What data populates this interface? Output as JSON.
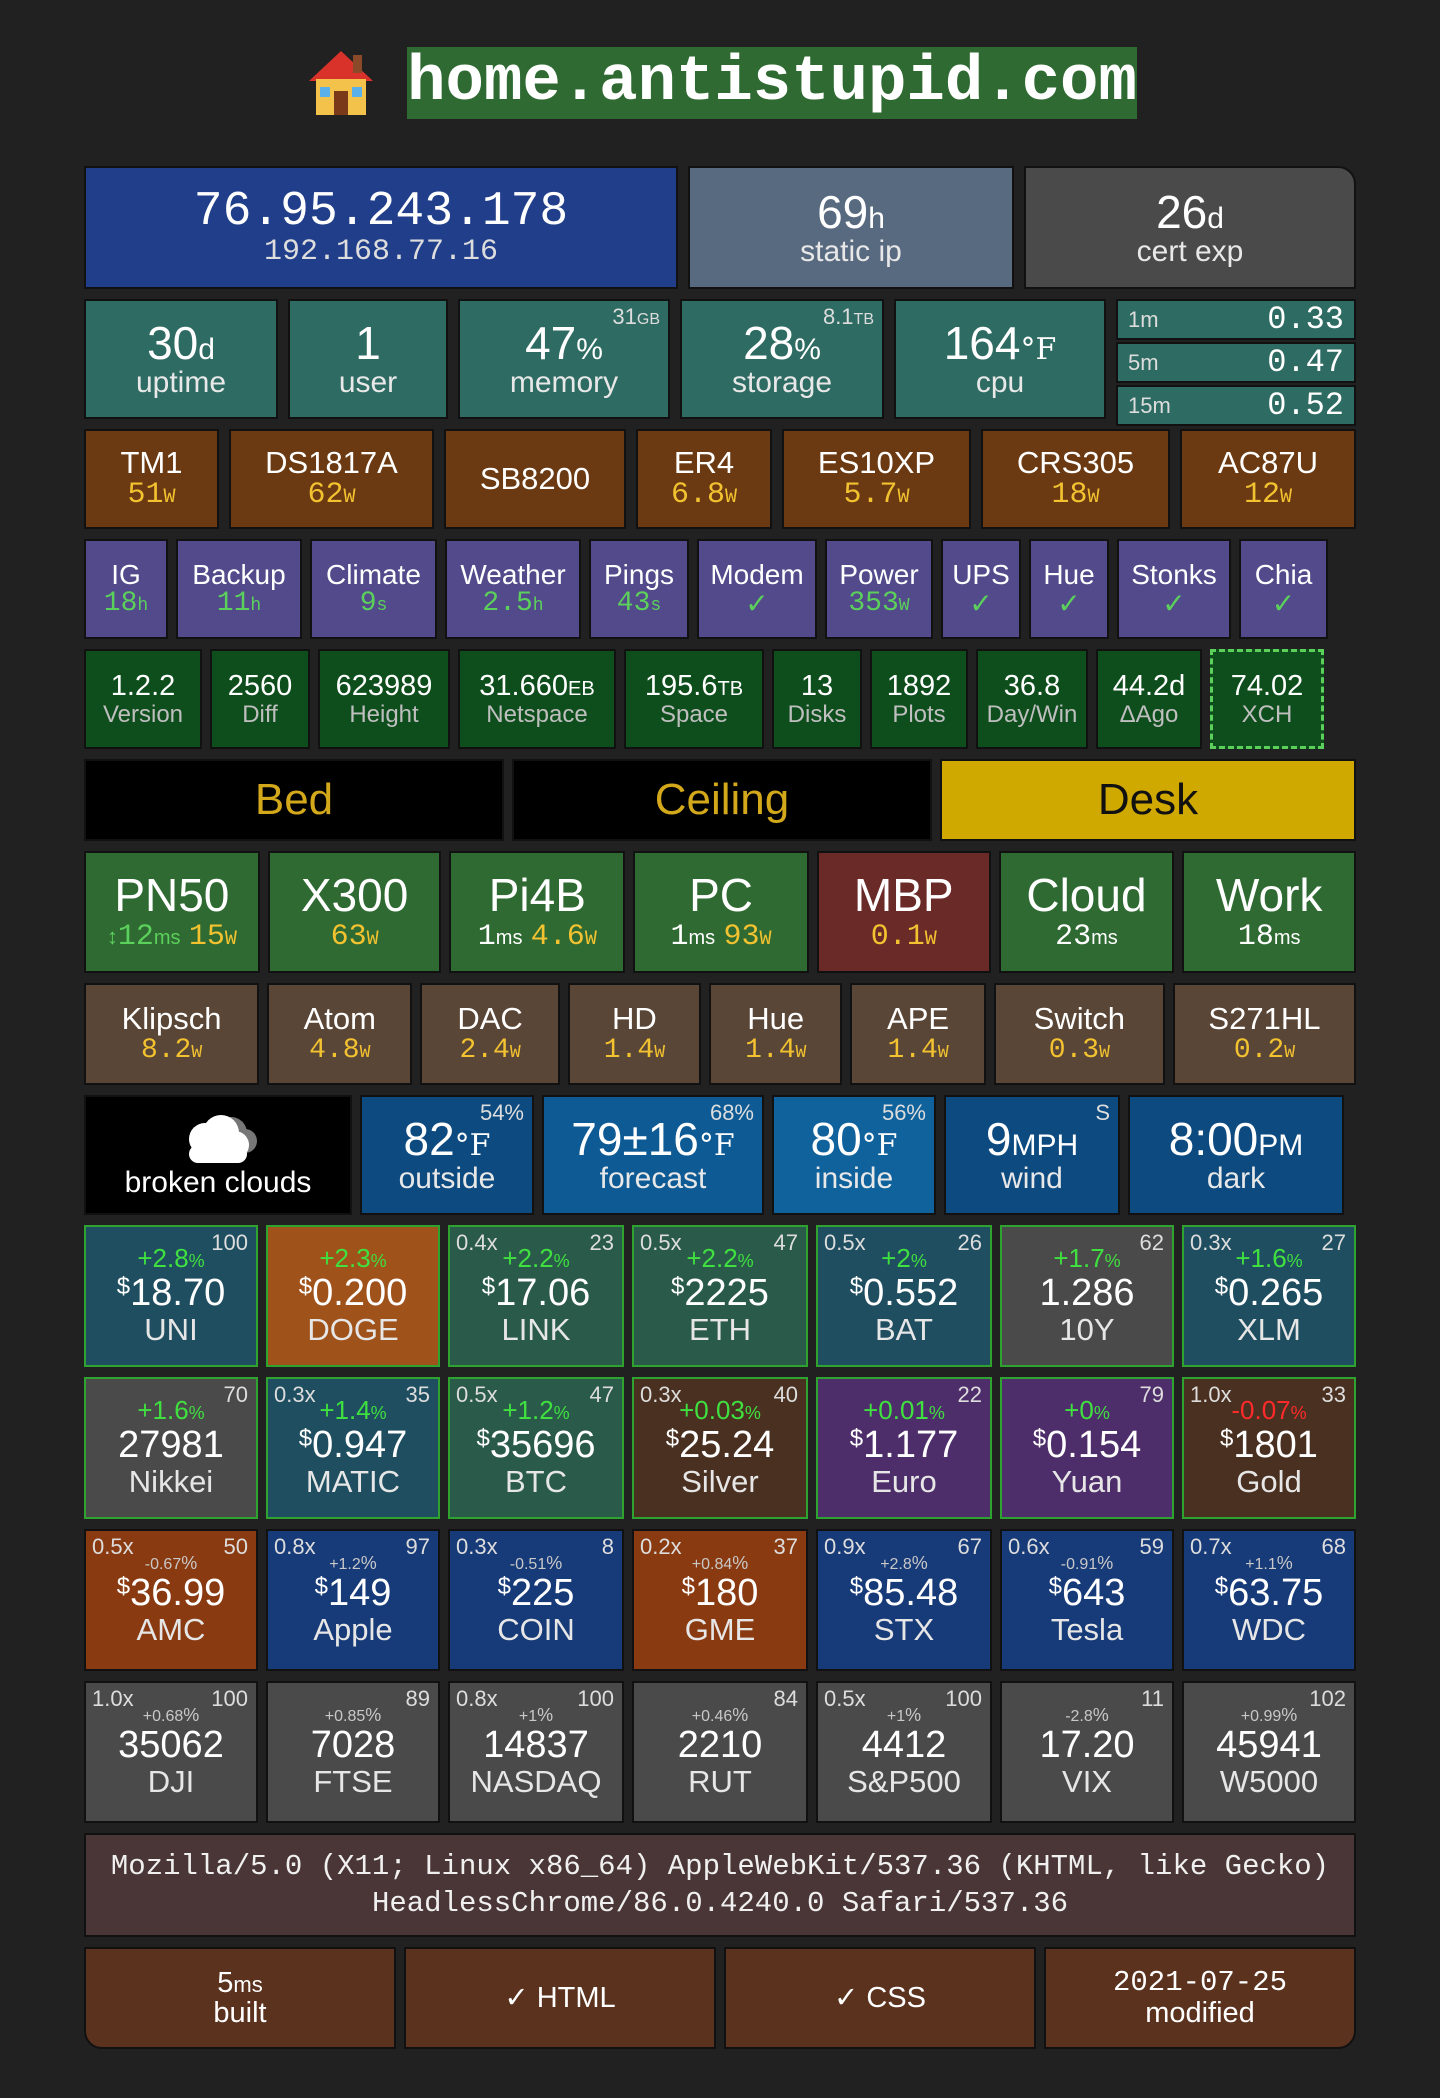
{
  "header": {
    "icon": "house-icon",
    "host": "home.antistupid.com"
  },
  "net": {
    "ip": "76.95.243.178",
    "lan": "192.168.77.16",
    "static_val": "69",
    "static_unit": "h",
    "static_lbl": "static ip",
    "cert_val": "26",
    "cert_unit": "d",
    "cert_lbl": "cert exp"
  },
  "sys": {
    "uptime_v": "30",
    "uptime_u": "d",
    "uptime_l": "uptime",
    "user_v": "1",
    "user_l": "user",
    "mem_v": "47",
    "mem_u": "%",
    "mem_l": "memory",
    "mem_c": "31",
    "mem_cu": "GB",
    "sto_v": "28",
    "sto_u": "%",
    "sto_l": "storage",
    "sto_c": "8.1",
    "sto_cu": "TB",
    "cpu_v": "164",
    "cpu_u": "°F",
    "cpu_l": "cpu",
    "load": [
      {
        "k": "1m",
        "v": "0.33"
      },
      {
        "k": "5m",
        "v": "0.47"
      },
      {
        "k": "15m",
        "v": "0.52"
      }
    ]
  },
  "devices": [
    {
      "n": "TM1",
      "w": "51",
      "u": "W"
    },
    {
      "n": "DS1817A",
      "w": "62",
      "u": "W"
    },
    {
      "n": "SB8200",
      "w": "",
      "u": ""
    },
    {
      "n": "ER4",
      "w": "6.8",
      "u": "W"
    },
    {
      "n": "ES10XP",
      "w": "5.7",
      "u": "W"
    },
    {
      "n": "CRS305",
      "w": "18",
      "u": "W"
    },
    {
      "n": "AC87U",
      "w": "12",
      "u": "W"
    }
  ],
  "services": [
    {
      "n": "IG",
      "v": "18",
      "u": "h"
    },
    {
      "n": "Backup",
      "v": "11",
      "u": "h"
    },
    {
      "n": "Climate",
      "v": "9",
      "u": "s"
    },
    {
      "n": "Weather",
      "v": "2.5",
      "u": "h"
    },
    {
      "n": "Pings",
      "v": "43",
      "u": "s"
    },
    {
      "n": "Modem",
      "v": "✓",
      "u": ""
    },
    {
      "n": "Power",
      "v": "353",
      "u": "W"
    },
    {
      "n": "UPS",
      "v": "✓",
      "u": ""
    },
    {
      "n": "Hue",
      "v": "✓",
      "u": ""
    },
    {
      "n": "Stonks",
      "v": "✓",
      "u": ""
    },
    {
      "n": "Chia",
      "v": "✓",
      "u": ""
    }
  ],
  "chia": [
    {
      "v": "1.2.2",
      "u": "",
      "l": "Version"
    },
    {
      "v": "2560",
      "u": "",
      "l": "Diff"
    },
    {
      "v": "623989",
      "u": "",
      "l": "Height"
    },
    {
      "v": "31.660",
      "u": "EB",
      "l": "Netspace"
    },
    {
      "v": "195.6",
      "u": "TB",
      "l": "Space"
    },
    {
      "v": "13",
      "u": "",
      "l": "Disks"
    },
    {
      "v": "1892",
      "u": "",
      "l": "Plots"
    },
    {
      "v": "36.8",
      "u": "",
      "l": "Day/Win"
    },
    {
      "v": "44.2d",
      "u": "",
      "l": "ΔAgo"
    },
    {
      "v": "74.02",
      "u": "",
      "l": "XCH"
    }
  ],
  "lights": [
    {
      "n": "Bed",
      "on": false
    },
    {
      "n": "Ceiling",
      "on": false
    },
    {
      "n": "Desk",
      "on": true
    }
  ],
  "hosts": [
    {
      "n": "PN50",
      "pre": "↕",
      "ms": "12",
      "w": "15"
    },
    {
      "n": "X300",
      "pre": "",
      "ms": "",
      "w": "63"
    },
    {
      "n": "Pi4B",
      "pre": "",
      "ms": "1",
      "w": "4.6"
    },
    {
      "n": "PC",
      "pre": "",
      "ms": "1",
      "w": "93"
    },
    {
      "n": "MBP",
      "pre": "",
      "ms": "",
      "w": "0.1"
    },
    {
      "n": "Cloud",
      "pre": "",
      "ms": "23",
      "w": ""
    },
    {
      "n": "Work",
      "pre": "",
      "ms": "18",
      "w": ""
    }
  ],
  "speakers": [
    {
      "n": "Klipsch",
      "w": "8.2"
    },
    {
      "n": "Atom",
      "w": "4.8"
    },
    {
      "n": "DAC",
      "w": "2.4"
    },
    {
      "n": "HD",
      "w": "1.4"
    },
    {
      "n": "Hue",
      "w": "1.4"
    },
    {
      "n": "APE",
      "w": "1.4"
    },
    {
      "n": "Switch",
      "w": "0.3"
    },
    {
      "n": "S271HL",
      "w": "0.2"
    }
  ],
  "weather": {
    "cond": "broken clouds",
    "cond_icon": "cloud-icon",
    "out_v": "82",
    "out_u": "°F",
    "out_h": "54%",
    "out_l": "outside",
    "fc_v": "79±16",
    "fc_u": "°F",
    "fc_h": "68%",
    "fc_l": "forecast",
    "in_v": "80",
    "in_u": "°F",
    "in_h": "56%",
    "in_l": "inside",
    "wind_v": "9",
    "wind_u": "MPH",
    "wind_d": "S",
    "wind_l": "wind",
    "time_v": "8:00",
    "time_u": "PM",
    "time_l": "dark"
  },
  "quotes": [
    [
      {
        "n": "UNI",
        "p": "$",
        "v": "18.70",
        "c": "+2.8",
        "x": "",
        "r": "100",
        "bg": "#1e4e60",
        "d": "up"
      },
      {
        "n": "DOGE",
        "p": "$",
        "v": "0.200",
        "c": "+2.3",
        "x": "",
        "r": "",
        "bg": "#a0521b",
        "d": "up"
      },
      {
        "n": "LINK",
        "p": "$",
        "v": "17.06",
        "c": "+2.2",
        "x": "0.4x",
        "r": "23",
        "bg": "#2a5a4a",
        "d": "up"
      },
      {
        "n": "ETH",
        "p": "$",
        "v": "2225",
        "c": "+2.2",
        "x": "0.5x",
        "r": "47",
        "bg": "#2a5a4a",
        "d": "up"
      },
      {
        "n": "BAT",
        "p": "$",
        "v": "0.552",
        "c": "+2",
        "x": "0.5x",
        "r": "26",
        "bg": "#1e4e60",
        "d": "up"
      },
      {
        "n": "10Y",
        "p": "",
        "v": "1.286",
        "c": "+1.7",
        "x": "",
        "r": "62",
        "bg": "#4a4a4a",
        "d": "up"
      },
      {
        "n": "XLM",
        "p": "$",
        "v": "0.265",
        "c": "+1.6",
        "x": "0.3x",
        "r": "27",
        "bg": "#1e4e60",
        "d": "up"
      }
    ],
    [
      {
        "n": "Nikkei",
        "p": "",
        "v": "27981",
        "c": "+1.6",
        "x": "",
        "r": "70",
        "bg": "#4a4a4a",
        "d": "up"
      },
      {
        "n": "MATIC",
        "p": "$",
        "v": "0.947",
        "c": "+1.4",
        "x": "0.3x",
        "r": "35",
        "bg": "#1e4e60",
        "d": "up"
      },
      {
        "n": "BTC",
        "p": "$",
        "v": "35696",
        "c": "+1.2",
        "x": "0.5x",
        "r": "47",
        "bg": "#2a5a4a",
        "d": "up"
      },
      {
        "n": "Silver",
        "p": "$",
        "v": "25.24",
        "c": "+0.03",
        "x": "0.3x",
        "r": "40",
        "bg": "#4a3020",
        "d": "up"
      },
      {
        "n": "Euro",
        "p": "$",
        "v": "1.177",
        "c": "+0.01",
        "x": "",
        "r": "22",
        "bg": "#4e2e6a",
        "d": "up"
      },
      {
        "n": "Yuan",
        "p": "$",
        "v": "0.154",
        "c": "+0",
        "x": "",
        "r": "79",
        "bg": "#4e2e6a",
        "d": "up"
      },
      {
        "n": "Gold",
        "p": "$",
        "v": "1801",
        "c": "-0.07",
        "x": "1.0x",
        "r": "33",
        "bg": "#4a3020",
        "d": "dn"
      }
    ],
    [
      {
        "n": "AMC",
        "p": "$",
        "v": "36.99",
        "c": "-0.67",
        "x": "0.5x",
        "r": "50",
        "bg": "#8a3a10",
        "d": "ne"
      },
      {
        "n": "Apple",
        "p": "$",
        "v": "149",
        "c": "+1.2",
        "x": "0.8x",
        "r": "97",
        "bg": "#173a78",
        "d": "ne"
      },
      {
        "n": "COIN",
        "p": "$",
        "v": "225",
        "c": "-0.51",
        "x": "0.3x",
        "r": "8",
        "bg": "#173a78",
        "d": "ne"
      },
      {
        "n": "GME",
        "p": "$",
        "v": "180",
        "c": "+0.84",
        "x": "0.2x",
        "r": "37",
        "bg": "#8a3a10",
        "d": "ne"
      },
      {
        "n": "STX",
        "p": "$",
        "v": "85.48",
        "c": "+2.8",
        "x": "0.9x",
        "r": "67",
        "bg": "#173a78",
        "d": "ne"
      },
      {
        "n": "Tesla",
        "p": "$",
        "v": "643",
        "c": "-0.91",
        "x": "0.6x",
        "r": "59",
        "bg": "#173a78",
        "d": "ne"
      },
      {
        "n": "WDC",
        "p": "$",
        "v": "63.75",
        "c": "+1.1",
        "x": "0.7x",
        "r": "68",
        "bg": "#173a78",
        "d": "ne"
      }
    ],
    [
      {
        "n": "DJI",
        "p": "",
        "v": "35062",
        "c": "+0.68",
        "x": "1.0x",
        "r": "100",
        "bg": "#4a4a4a",
        "d": "ne"
      },
      {
        "n": "FTSE",
        "p": "",
        "v": "7028",
        "c": "+0.85",
        "x": "",
        "r": "89",
        "bg": "#4a4a4a",
        "d": "ne"
      },
      {
        "n": "NASDAQ",
        "p": "",
        "v": "14837",
        "c": "+1",
        "x": "0.8x",
        "r": "100",
        "bg": "#4a4a4a",
        "d": "ne"
      },
      {
        "n": "RUT",
        "p": "",
        "v": "2210",
        "c": "+0.46",
        "x": "",
        "r": "84",
        "bg": "#4a4a4a",
        "d": "ne"
      },
      {
        "n": "S&P500",
        "p": "",
        "v": "4412",
        "c": "+1",
        "x": "0.5x",
        "r": "100",
        "bg": "#4a4a4a",
        "d": "ne"
      },
      {
        "n": "VIX",
        "p": "",
        "v": "17.20",
        "c": "-2.8",
        "x": "",
        "r": "11",
        "bg": "#4a4a4a",
        "d": "ne"
      },
      {
        "n": "W5000",
        "p": "",
        "v": "45941",
        "c": "+0.99",
        "x": "",
        "r": "102",
        "bg": "#4a4a4a",
        "d": "ne"
      }
    ]
  ],
  "ua": "Mozilla/5.0 (X11; Linux x86_64) AppleWebKit/537.36 (KHTML, like Gecko) HeadlessChrome/86.0.4240.0 Safari/537.36",
  "footer": {
    "built_v": "5",
    "built_u": "ms",
    "built_l": "built",
    "html": "✓ HTML",
    "css": "✓ CSS",
    "mod_v": "2021-07-25",
    "mod_l": "modified"
  }
}
